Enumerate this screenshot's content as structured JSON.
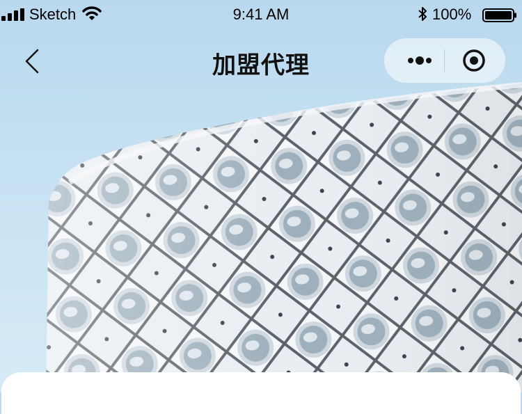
{
  "status_bar": {
    "carrier": "Sketch",
    "time": "9:41 AM",
    "battery": "100%",
    "icons": [
      "signal-icon",
      "wifi-icon",
      "bluetooth-icon",
      "battery-icon"
    ]
  },
  "nav": {
    "title": "加盟代理",
    "back_icon": "chevron-left-icon",
    "more_icon": "more-dots-icon",
    "close_icon": "target-circle-icon"
  },
  "colors": {
    "sky": "#bcd9ef",
    "card": "#ffffff",
    "title": "#111111"
  }
}
